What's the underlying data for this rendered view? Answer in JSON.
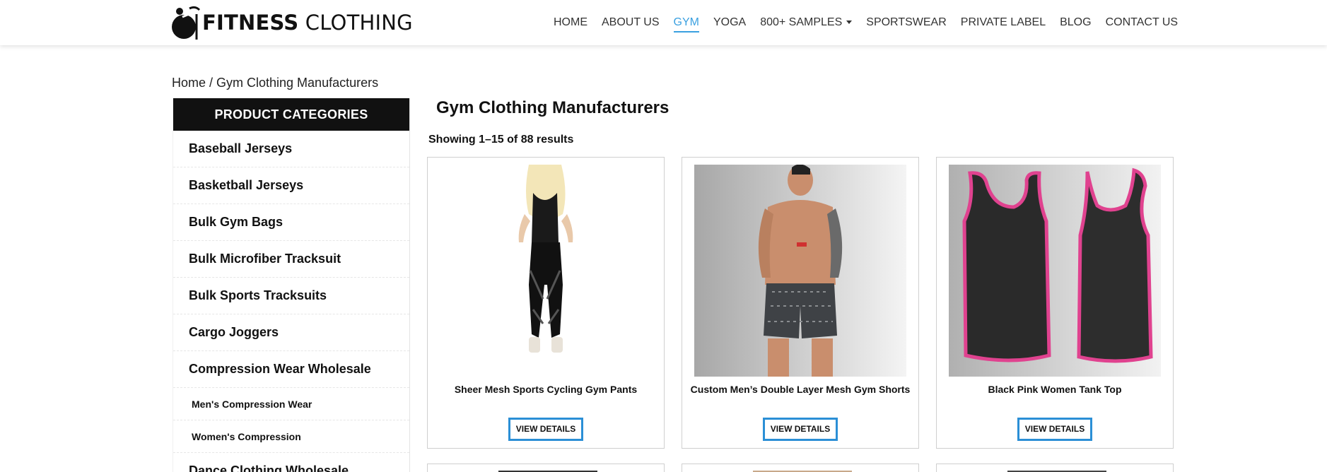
{
  "header": {
    "logo": {
      "text_bold": "FITNESS",
      "text_regular": "CLOTHING"
    },
    "nav": [
      {
        "label": "HOME",
        "active": false
      },
      {
        "label": "ABOUT US",
        "active": false
      },
      {
        "label": "GYM",
        "active": true
      },
      {
        "label": "YOGA",
        "active": false
      },
      {
        "label": "800+ SAMPLES",
        "active": false,
        "dropdown": true
      },
      {
        "label": "SPORTSWEAR",
        "active": false
      },
      {
        "label": "PRIVATE LABEL",
        "active": false
      },
      {
        "label": "BLOG",
        "active": false
      },
      {
        "label": "CONTACT US",
        "active": false
      }
    ]
  },
  "breadcrumb": {
    "text": "Home / Gym Clothing Manufacturers"
  },
  "sidebar": {
    "title": "PRODUCT CATEGORIES",
    "items": [
      {
        "label": "Baseball Jerseys"
      },
      {
        "label": "Basketball Jerseys"
      },
      {
        "label": "Bulk Gym Bags"
      },
      {
        "label": "Bulk Microfiber Tracksuit"
      },
      {
        "label": "Bulk Sports Tracksuits"
      },
      {
        "label": "Cargo Joggers"
      },
      {
        "label": "Compression Wear Wholesale"
      }
    ],
    "subitems": [
      {
        "label": "Men's Compression Wear"
      },
      {
        "label": "Women's Compression"
      }
    ],
    "partial_item": {
      "label": "Dance Clothing Wholesale"
    }
  },
  "main": {
    "title": "Gym Clothing Manufacturers",
    "result_count": "Showing 1–15 of 88 results",
    "products": [
      {
        "name": "Sheer Mesh Sports Cycling Gym Pants",
        "button": "VIEW DETAILS",
        "image_icon": "leggings-photo"
      },
      {
        "name": "Custom Men’s Double Layer Mesh Gym Shorts",
        "button": "VIEW DETAILS",
        "image_icon": "gym-shorts-photo"
      },
      {
        "name": "Black Pink Women Tank Top",
        "button": "VIEW DETAILS",
        "image_icon": "tank-top-photo"
      }
    ]
  },
  "colors": {
    "accent": "#3aa0e0",
    "button_border": "#2b8fd6",
    "sidebar_head": "#111111",
    "tank_trim": "#e0428f"
  }
}
